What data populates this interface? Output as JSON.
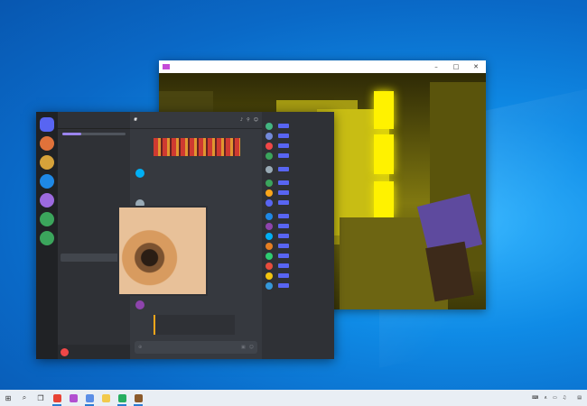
{
  "colors": {
    "desktop": "#0a69c7",
    "discord_bg": "#36393f",
    "discord_accent": "#5865f2",
    "game_yellow": "#fff200"
  },
  "game_window": {
    "title": "",
    "minimize_icon": "minimize-icon",
    "maximize_icon": "maximize-icon",
    "close_icon": "close-icon"
  },
  "discord": {
    "server_name": "",
    "channel_header": "",
    "servers": [
      {
        "icon": "home-icon",
        "color": "#5865f2"
      },
      {
        "icon": "server",
        "color": "#e0723a"
      },
      {
        "icon": "server",
        "color": "#d6a23a"
      },
      {
        "icon": "server",
        "color": "#1e88e5"
      },
      {
        "icon": "server",
        "color": "#9c6adf"
      },
      {
        "icon": "add-server-icon",
        "color": "#3ba55c"
      },
      {
        "icon": "explore-icon",
        "color": "#3ba55c"
      }
    ],
    "channels": [
      {
        "label": "",
        "active": false
      },
      {
        "label": "",
        "active": false
      },
      {
        "label": "",
        "active": false
      },
      {
        "label": "",
        "active": false
      },
      {
        "label": "",
        "active": false
      },
      {
        "label": "",
        "active": false
      },
      {
        "label": "",
        "active": false
      },
      {
        "label": "",
        "active": false
      },
      {
        "label": "",
        "active": false
      },
      {
        "label": "",
        "active": false
      },
      {
        "label": "",
        "active": false
      },
      {
        "label": "",
        "active": false
      },
      {
        "label": "",
        "active": false
      },
      {
        "label": "",
        "active": true
      },
      {
        "label": "",
        "active": false
      },
      {
        "label": "",
        "active": false
      }
    ],
    "user_name": "",
    "messages": [
      {
        "name": "",
        "name_color": "#00aff4",
        "text": ""
      },
      {
        "name": "",
        "name_color": "#f47fff",
        "text": ""
      },
      {
        "name": "",
        "name_color": "#3ba55c",
        "text": ""
      }
    ],
    "composer_placeholder": "",
    "member_groups": [
      {
        "label": "",
        "members": [
          {
            "name": "",
            "color": "#3ba55c",
            "avatar": "#43b581"
          },
          {
            "name": "",
            "color": "#b9bbbe",
            "avatar": "#7289da"
          },
          {
            "name": "",
            "color": "#b9bbbe",
            "avatar": "#f04747"
          },
          {
            "name": "",
            "color": "#b9bbbe",
            "avatar": "#3ba55c"
          }
        ]
      },
      {
        "label": "",
        "members": [
          {
            "name": "",
            "color": "#b9bbbe",
            "avatar": "#99aab5"
          }
        ]
      },
      {
        "label": "",
        "members": [
          {
            "name": "",
            "color": "#b9bbbe",
            "avatar": "#3ba55c"
          },
          {
            "name": "",
            "color": "#f47fff",
            "avatar": "#faa61a"
          },
          {
            "name": "",
            "color": "#b9bbbe",
            "avatar": "#5865f2"
          }
        ]
      },
      {
        "label": "",
        "members": [
          {
            "name": "",
            "color": "#faa61a",
            "avatar": "#1e88e5"
          },
          {
            "name": "",
            "color": "#faa61a",
            "avatar": "#8e44ad"
          },
          {
            "name": "",
            "color": "#faa61a",
            "avatar": "#00aff4"
          },
          {
            "name": "",
            "color": "#faa61a",
            "avatar": "#e67e22"
          },
          {
            "name": "",
            "color": "#faa61a",
            "avatar": "#2ecc71"
          },
          {
            "name": "",
            "color": "#faa61a",
            "avatar": "#e74c3c"
          },
          {
            "name": "",
            "color": "#faa61a",
            "avatar": "#f1c40f"
          },
          {
            "name": "",
            "color": "#faa61a",
            "avatar": "#3498db"
          }
        ]
      }
    ]
  },
  "taskbar": {
    "apps": [
      {
        "icon": "chrome-icon",
        "color": "#e84335",
        "active": true
      },
      {
        "icon": "media-icon",
        "color": "#b24fd0",
        "active": false
      },
      {
        "icon": "app-icon",
        "color": "#5b8ee6",
        "active": true
      },
      {
        "icon": "folder-icon",
        "color": "#f2c94c",
        "active": false
      },
      {
        "icon": "app-icon",
        "color": "#27ae60",
        "active": true
      },
      {
        "icon": "game-icon",
        "color": "#8b5a2b",
        "active": true
      }
    ],
    "time": "",
    "date": ""
  }
}
